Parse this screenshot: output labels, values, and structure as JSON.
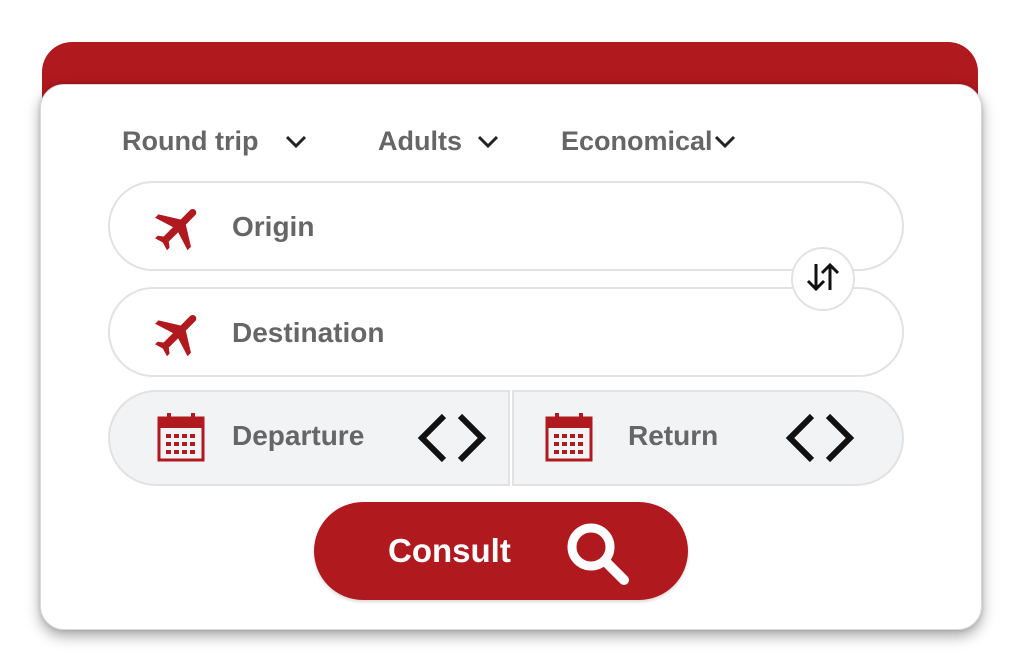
{
  "trip_options": {
    "trip_type": "Round trip",
    "passengers": "Adults",
    "cabin_class": "Economical"
  },
  "origin": {
    "placeholder": "Origin"
  },
  "destination": {
    "placeholder": "Destination"
  },
  "dates": {
    "departure": "Departure",
    "return": "Return"
  },
  "consult_button": {
    "label": "Consult"
  },
  "icons": {
    "origin": "airplane-icon",
    "destination": "airplane-icon",
    "swap": "swap-arrows-icon",
    "departure": "calendar-icon",
    "departure_nav": "prev-next-chevrons-icon",
    "return": "calendar-icon",
    "return_nav": "prev-next-chevrons-icon",
    "search": "magnifier-icon",
    "dropdown": "chevron-down-icon"
  },
  "colors": {
    "brand_red": "#b0191e",
    "label_gray": "#666666",
    "field_border": "#e2e2e2",
    "date_bg": "#f2f3f5"
  }
}
